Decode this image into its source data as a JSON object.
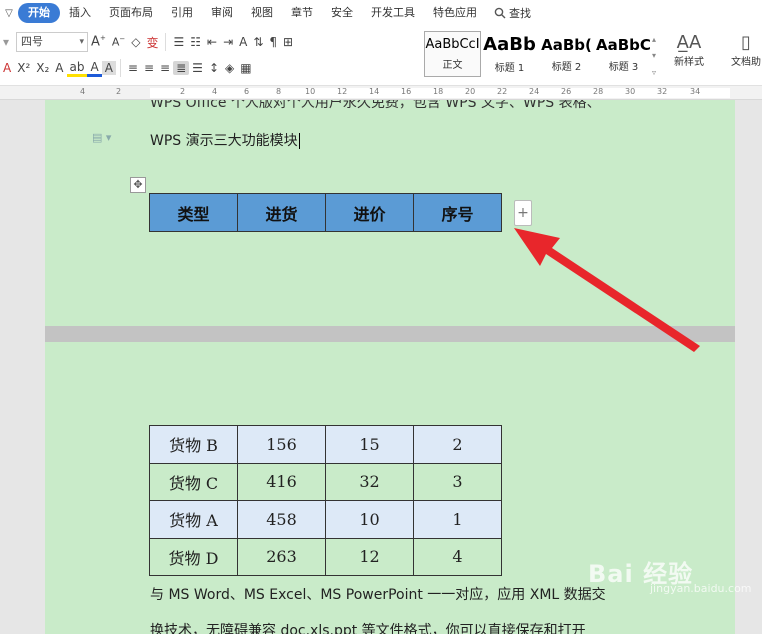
{
  "menu": {
    "collapse": "▽",
    "tabs": [
      {
        "label": "开始"
      },
      {
        "label": "插入"
      },
      {
        "label": "页面布局"
      },
      {
        "label": "引用"
      },
      {
        "label": "审阅"
      },
      {
        "label": "视图"
      },
      {
        "label": "章节"
      },
      {
        "label": "安全"
      },
      {
        "label": "开发工具"
      },
      {
        "label": "特色应用"
      }
    ],
    "search_label": "查找"
  },
  "toolbar": {
    "font_size": "四号",
    "styles": [
      {
        "sample": "AaBbCcI",
        "name": "正文"
      },
      {
        "sample": "AaBb",
        "name": "标题 1"
      },
      {
        "sample": "AaBb(",
        "name": "标题 2"
      },
      {
        "sample": "AaBbC(",
        "name": "标题 3"
      }
    ],
    "new_style": "新样式",
    "doc_assist": "文档助"
  },
  "ruler": {
    "numbers": [
      "4",
      "2",
      "2",
      "4",
      "6",
      "8",
      "10",
      "12",
      "14",
      "16",
      "18",
      "20",
      "22",
      "24",
      "26",
      "28",
      "30",
      "32",
      "34"
    ]
  },
  "document": {
    "cut_line": "WPS Office 个人版对个人用户永久免费，包含 WPS 文字、WPS 表格、",
    "line2": "WPS 演示三大功能模块",
    "header_row": [
      "类型",
      "进货",
      "进价",
      "序号"
    ],
    "rows": [
      [
        "货物 B",
        "156",
        "15",
        "2"
      ],
      [
        "货物 C",
        "416",
        "32",
        "3"
      ],
      [
        "货物 A",
        "458",
        "10",
        "1"
      ],
      [
        "货物 D",
        "263",
        "12",
        "4"
      ]
    ],
    "para1": "与 MS Word、MS Excel、MS PowerPoint 一一对应，应用 XML 数据交",
    "para2": "换技术，无障碍兼容 doc.xls.ppt 等文件格式，你可以直接保存和打开"
  },
  "watermark": {
    "text": "Bai 经验",
    "sub": "jingyan.baidu.com"
  },
  "colors": {
    "page_bg": "#c9ebc9",
    "header_fill": "#5b9bd5",
    "row_alt": "#dde9f7",
    "arrow": "#e8262b",
    "accent": "#3a7bd5"
  }
}
